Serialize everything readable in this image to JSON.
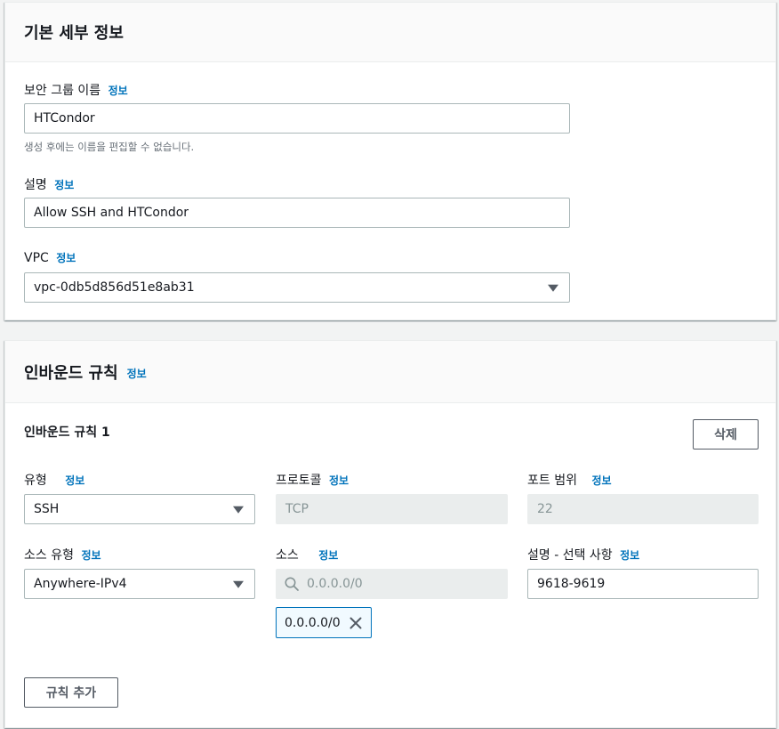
{
  "basic": {
    "title": "기본 세부 정보",
    "name_label": "보안 그룹 이름",
    "name_info": "정보",
    "name_value": "HTCondor",
    "name_hint": "생성 후에는 이름을 편집할 수 없습니다.",
    "desc_label": "설명",
    "desc_info": "정보",
    "desc_value": "Allow SSH and HTCondor",
    "vpc_label": "VPC",
    "vpc_info": "정보",
    "vpc_value": "vpc-0db5d856d51e8ab31"
  },
  "inbound": {
    "title": "인바운드 규칙",
    "title_info": "정보",
    "rule_title": "인바운드 규칙 1",
    "delete_label": "삭제",
    "type_label": "유형",
    "type_info": "정보",
    "type_value": "SSH",
    "protocol_label": "프로토콜",
    "protocol_info": "정보",
    "protocol_value": "TCP",
    "port_label": "포트 범위",
    "port_info": "정보",
    "port_value": "22",
    "source_type_label": "소스 유형",
    "source_type_info": "정보",
    "source_type_value": "Anywhere-IPv4",
    "source_label": "소스",
    "source_info": "정보",
    "source_placeholder": "0.0.0.0/0",
    "source_token": "0.0.0.0/0",
    "rule_desc_label": "설명 - 선택 사항",
    "rule_desc_info": "정보",
    "rule_desc_value": "9618-9619",
    "add_rule_label": "규칙 추가"
  },
  "icons": {
    "select_caret": "caret-down-icon",
    "search": "search-icon",
    "remove": "close-icon"
  },
  "colors": {
    "link": "#0073bb",
    "background": "#f2f3f3",
    "header_bg": "#fafafa",
    "disabled_bg": "#eaeded",
    "token_bg": "#f1faff"
  }
}
